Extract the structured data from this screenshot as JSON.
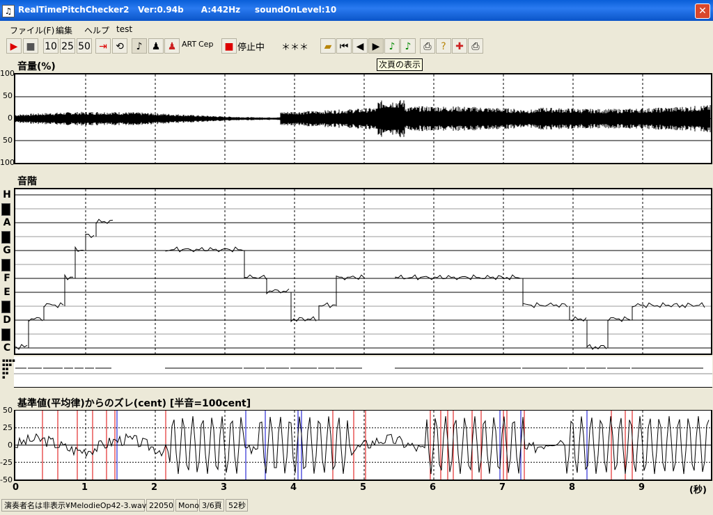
{
  "window": {
    "title": "RealTimePitchChecker2   Ver:0.94b      A:442Hz     soundOnLevel:10",
    "close_symbol": "✕",
    "app_icon_symbol": "♫"
  },
  "menu": [
    "ファイル(F)",
    "編集",
    "ヘルプ",
    "test"
  ],
  "toolbar": {
    "speed_buttons": [
      "10",
      "25",
      "50"
    ],
    "art_label": "ART",
    "cep_label": "Cep",
    "status_label": "停止中",
    "note_display": "＊＊＊",
    "tooltip": "次頁の表示"
  },
  "volume_panel": {
    "title": "音量(%)",
    "y_labels": [
      "100",
      "50",
      "0",
      "50",
      "100"
    ]
  },
  "scale_panel": {
    "title": "音階",
    "note_labels": [
      "H",
      "A",
      "G",
      "F",
      "E",
      "D",
      "C"
    ]
  },
  "deviation_panel": {
    "title": "基準値(平均律)からのズレ(cent) [半音=100cent]",
    "y_labels": [
      "50",
      "25",
      "0",
      "-25",
      "-50"
    ]
  },
  "x_axis": {
    "tick_labels": [
      "0",
      "1",
      "2",
      "3",
      "4",
      "5",
      "6",
      "7",
      "8",
      "9"
    ],
    "unit_label": "(秒)"
  },
  "status_bar": [
    "演奏者名は非表示¥MelodieOp42-3.wav",
    "22050",
    "Mono",
    "3/6頁",
    "52秒"
  ],
  "chart_data": {
    "type": "line",
    "x_range_seconds": [
      0,
      10
    ],
    "pitch_curve": {
      "notes_order_bottom_to_top": [
        "C",
        "C#",
        "D",
        "D#",
        "E",
        "F",
        "F#",
        "G",
        "G#",
        "A",
        "A#",
        "H"
      ],
      "segments": [
        {
          "x": [
            0.0,
            0.18
          ],
          "note": "C"
        },
        {
          "x": [
            0.18,
            0.4
          ],
          "note": "D"
        },
        {
          "x": [
            0.4,
            0.7
          ],
          "note": "D#"
        },
        {
          "x": [
            0.7,
            0.85
          ],
          "note": "F"
        },
        {
          "x": [
            0.85,
            1.0
          ],
          "note": "G"
        },
        {
          "x": [
            1.0,
            1.15
          ],
          "note": "G#"
        },
        {
          "x": [
            1.15,
            1.4
          ],
          "note": "A"
        },
        {
          "x": [
            2.15,
            3.28
          ],
          "note": "G"
        },
        {
          "x": [
            3.28,
            3.6
          ],
          "note": "F"
        },
        {
          "x": [
            3.6,
            3.95
          ],
          "note": "E"
        },
        {
          "x": [
            3.95,
            4.35
          ],
          "note": "D"
        },
        {
          "x": [
            4.35,
            4.6
          ],
          "note": "D#"
        },
        {
          "x": [
            4.6,
            5.0
          ],
          "note": "F"
        },
        {
          "x": [
            5.45,
            7.28
          ],
          "note": "F"
        },
        {
          "x": [
            7.28,
            7.95
          ],
          "note": "D#"
        },
        {
          "x": [
            7.95,
            8.2
          ],
          "note": "D"
        },
        {
          "x": [
            8.2,
            8.5
          ],
          "note": "C"
        },
        {
          "x": [
            8.5,
            8.85
          ],
          "note": "D"
        },
        {
          "x": [
            8.85,
            9.9
          ],
          "note": "D#"
        }
      ]
    },
    "deviation": {
      "ylim": [
        -50,
        50
      ],
      "red_marks_seconds": [
        0.38,
        0.6,
        0.88,
        1.1,
        1.3,
        1.42,
        2.15,
        4.55,
        4.85,
        5.02,
        5.95,
        6.1,
        6.2,
        6.28,
        6.55,
        6.68,
        7.0,
        7.05,
        7.3,
        8.55,
        8.75,
        8.85
      ],
      "blue_marks_seconds": [
        1.45,
        3.3,
        3.58,
        4.05,
        4.1,
        6.95,
        7.25,
        8.2
      ]
    }
  }
}
